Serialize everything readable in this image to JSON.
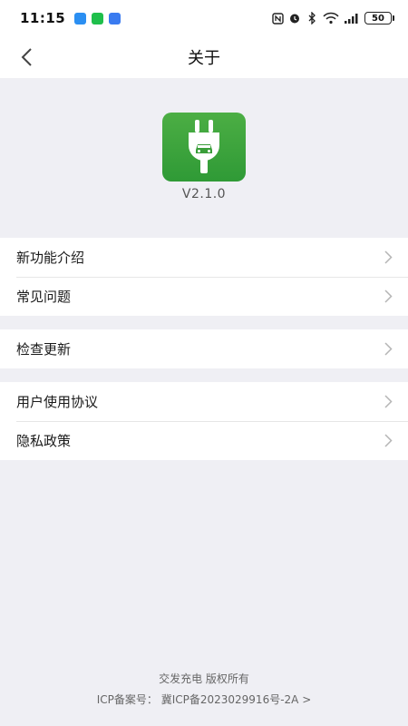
{
  "status_bar": {
    "time": "11:15",
    "battery": "50",
    "app_icons": [
      {
        "name": "feishu-icon",
        "color": "#2b8ff2"
      },
      {
        "name": "wechat-icon",
        "color": "#1fbf4b"
      },
      {
        "name": "signal-app-icon",
        "color": "#3a7bf0"
      }
    ]
  },
  "nav": {
    "title": "关于"
  },
  "app": {
    "version": "V2.1.0",
    "brand_color": "#3aa33c"
  },
  "menu_groups": [
    {
      "items": [
        {
          "label": "新功能介绍"
        },
        {
          "label": "常见问题"
        }
      ]
    },
    {
      "items": [
        {
          "label": "检查更新"
        }
      ]
    },
    {
      "items": [
        {
          "label": "用户使用协议"
        },
        {
          "label": "隐私政策"
        }
      ]
    }
  ],
  "footer": {
    "copyright": "交发充电 版权所有",
    "icp": "ICP备案号：  冀ICP备2023029916号-2A >"
  }
}
